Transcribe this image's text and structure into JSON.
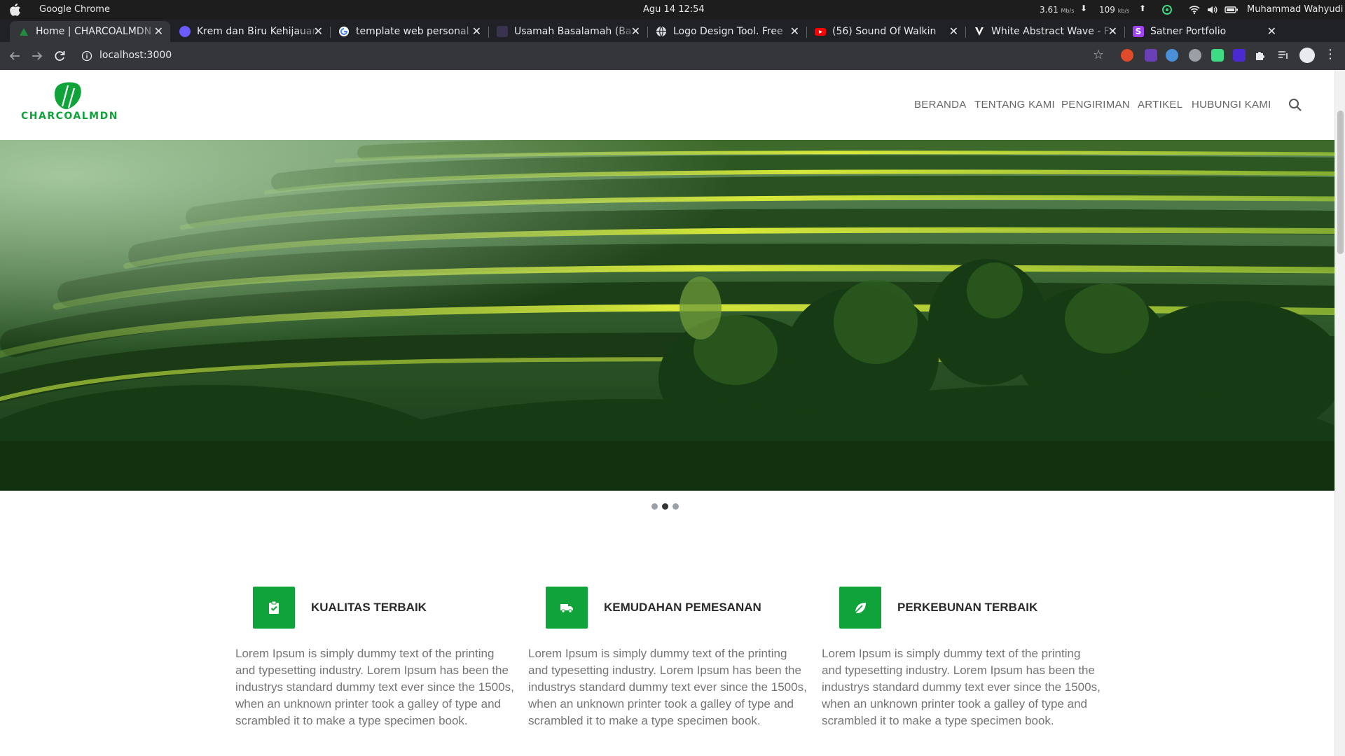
{
  "os": {
    "app_name": "Google Chrome",
    "clock": "Agu 14  12:54",
    "net_down_value": "3.61",
    "net_down_unit": "Mb/s",
    "net_up_value": "109",
    "net_up_unit": "kb/s",
    "user": "Muhammad Wahyudi"
  },
  "tabs": [
    {
      "title": "Home | CHARCOALMDN",
      "favicon_color": "#1e8e3e",
      "active": true
    },
    {
      "title": "Krem dan Biru Kehijauan",
      "favicon_color": "#6a5cff",
      "active": false
    },
    {
      "title": "template web personal",
      "favicon_color": "#ffffff",
      "active": false
    },
    {
      "title": "Usamah Basalamah (Ba",
      "favicon_color": "#7a6fa8",
      "active": false
    },
    {
      "title": "Logo Design Tool. Free",
      "favicon_color": "#dadce0",
      "active": false
    },
    {
      "title": "(56) Sound Of Walkin",
      "favicon_color": "#ff0000",
      "active": false
    },
    {
      "title": "White Abstract Wave - F",
      "favicon_color": "#7b3fe4",
      "active": false
    },
    {
      "title": "Satner Portfolio",
      "favicon_color": "#a142f4",
      "active": false
    }
  ],
  "toolbar": {
    "url": "localhost:3000"
  },
  "site": {
    "brand": "CHARCOALMDN",
    "brand_color": "#0fa33a",
    "nav": [
      "BERANDA",
      "TENTANG KAMI",
      "PENGIRIMAN",
      "ARTIKEL",
      "HUBUNGI KAMI"
    ],
    "slider_active_index": 1,
    "slider_count": 3,
    "features": [
      {
        "icon": "clipboard-check-icon",
        "title": "KUALITAS TERBAIK",
        "text": "Lorem Ipsum is simply dummy text of the printing and typesetting industry. Lorem Ipsum has been the industrys standard dummy text ever since the 1500s, when an unknown printer took a galley of type and scrambled it to make a type specimen book."
      },
      {
        "icon": "truck-icon",
        "title": "KEMUDAHAN PEMESANAN",
        "text": "Lorem Ipsum is simply dummy text of the printing and typesetting industry. Lorem Ipsum has been the industrys standard dummy text ever since the 1500s, when an unknown printer took a galley of type and scrambled it to make a type specimen book."
      },
      {
        "icon": "leaf-icon",
        "title": "PERKEBUNAN TERBAIK",
        "text": "Lorem Ipsum is simply dummy text of the printing and typesetting industry. Lorem Ipsum has been the industrys standard dummy text ever since the 1500s, when an unknown printer took a galley of type and scrambled it to make a type specimen book."
      }
    ]
  }
}
